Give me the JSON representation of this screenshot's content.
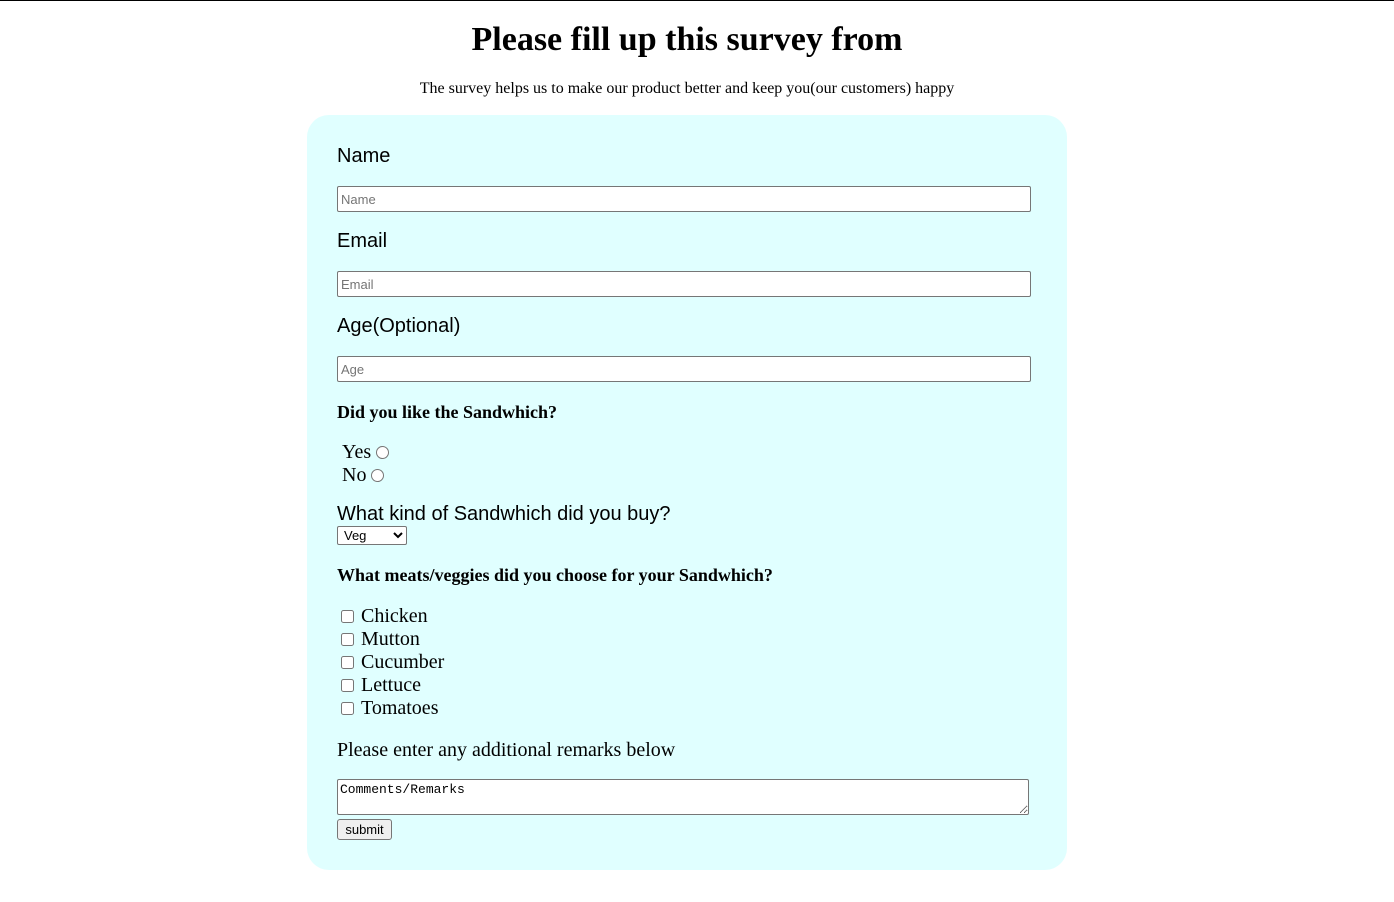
{
  "page": {
    "title": "Please fill up this survey from",
    "description": "The survey helps us to make our product better and keep you(our customers) happy"
  },
  "form": {
    "name": {
      "label": "Name",
      "placeholder": "Name",
      "value": ""
    },
    "email": {
      "label": "Email",
      "placeholder": "Email",
      "value": ""
    },
    "age": {
      "label": "Age(Optional)",
      "placeholder": "Age",
      "value": ""
    },
    "liked": {
      "question": "Did you like the Sandwhich?",
      "options": [
        {
          "label": "Yes",
          "checked": false
        },
        {
          "label": "No",
          "checked": false
        }
      ]
    },
    "sandwich_type": {
      "label": "What kind of Sandwhich did you buy?",
      "selected": "Veg"
    },
    "fillings": {
      "question": "What meats/veggies did you choose for your Sandwhich?",
      "options": [
        {
          "label": "Chicken",
          "checked": false
        },
        {
          "label": "Mutton",
          "checked": false
        },
        {
          "label": "Cucumber",
          "checked": false
        },
        {
          "label": "Lettuce",
          "checked": false
        },
        {
          "label": "Tomatoes",
          "checked": false
        }
      ]
    },
    "remarks": {
      "label": "Please enter any additional remarks below",
      "value": "Comments/Remarks"
    },
    "submit_label": "submit"
  },
  "colors": {
    "card_background": "#e0ffff",
    "page_background": "#ffffff"
  }
}
